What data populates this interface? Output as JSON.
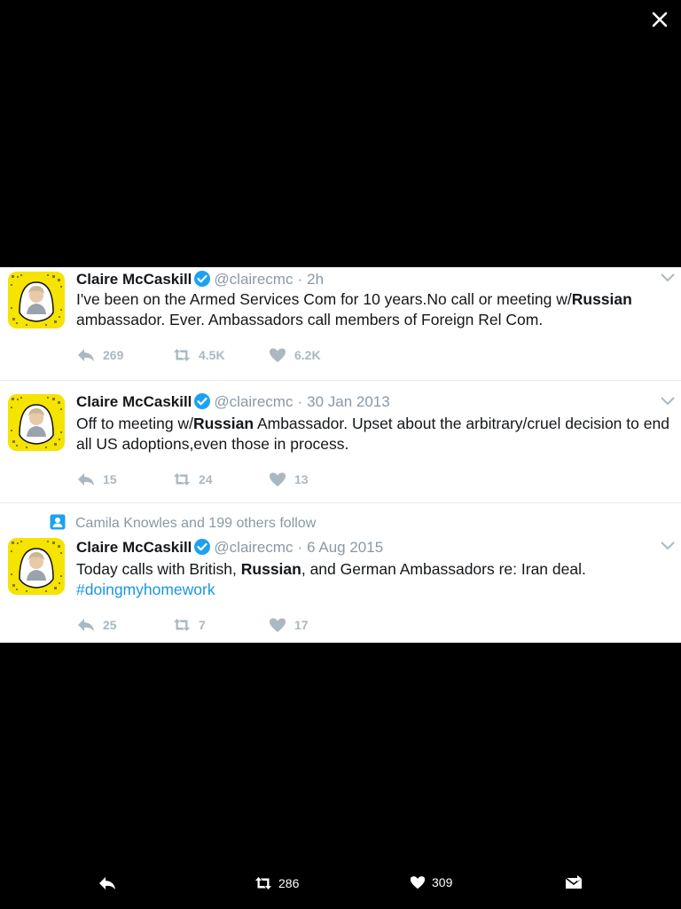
{
  "viewer": {
    "close_icon": "close-icon"
  },
  "tweets": [
    {
      "name": "Claire McCaskill",
      "handle": "@clairecmc",
      "separator": "·",
      "time": "2h",
      "text_parts": [
        "I've been on the Armed Services Com for 10 years.No call or meeting w/",
        "Russian",
        " ambassador. Ever. Ambassadors call members of Foreign Rel Com."
      ],
      "replies": "269",
      "retweets": "4.5K",
      "likes": "6.2K"
    },
    {
      "name": "Claire McCaskill",
      "handle": "@clairecmc",
      "separator": "·",
      "time": "30 Jan 2013",
      "text_parts": [
        "Off to meeting w/",
        "Russian",
        " Ambassador. Upset about the arbitrary/cruel decision to end all US adoptions,even those in process."
      ],
      "replies": "15",
      "retweets": "24",
      "likes": "13"
    },
    {
      "social_context": "Camila Knowles and 199 others follow",
      "name": "Claire McCaskill",
      "handle": "@clairecmc",
      "separator": "·",
      "time": "6 Aug 2015",
      "text_parts": [
        "Today calls with British, ",
        "Russian",
        ", and German Ambassadors re: Iran deal."
      ],
      "hashtag": "#doingmyhomework",
      "replies": "25",
      "retweets": "7",
      "likes": "17"
    }
  ],
  "bottom_bar": {
    "retweets": "286",
    "likes": "309"
  },
  "colors": {
    "background": "#000000",
    "card": "#ffffff",
    "verified": "#1da1f2",
    "hashtag": "#1b95e0",
    "muted": "#8899a6",
    "action": "#aab8c2",
    "avatar": "#f5e300"
  }
}
